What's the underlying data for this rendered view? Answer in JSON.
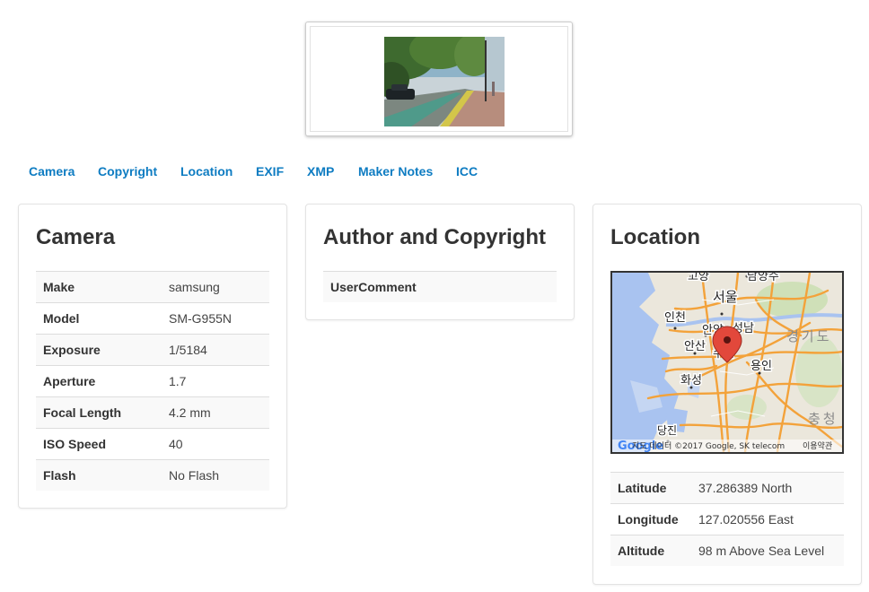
{
  "nav": {
    "tabs": [
      "Camera",
      "Copyright",
      "Location",
      "EXIF",
      "XMP",
      "Maker Notes",
      "ICC"
    ]
  },
  "camera": {
    "title": "Camera",
    "rows": [
      {
        "key": "Make",
        "value": "samsung"
      },
      {
        "key": "Model",
        "value": "SM-G955N"
      },
      {
        "key": "Exposure",
        "value": "1/5184"
      },
      {
        "key": "Aperture",
        "value": "1.7"
      },
      {
        "key": "Focal Length",
        "value": "4.2 mm"
      },
      {
        "key": "ISO Speed",
        "value": "40"
      },
      {
        "key": "Flash",
        "value": "No Flash"
      }
    ]
  },
  "copyright": {
    "title": "Author and Copyright",
    "rows": [
      {
        "key": "UserComment",
        "value": ""
      }
    ]
  },
  "location": {
    "title": "Location",
    "map": {
      "labels": {
        "goyang": "고양",
        "namyangju": "남양주",
        "seoul": "서울",
        "incheon": "인천",
        "anyang": "안양",
        "seongnam": "성남",
        "gyeonggi": "경기도",
        "ansan": "안산",
        "suwon": "수원",
        "yongin": "용인",
        "hwaseong": "화성",
        "chungcheong": "충청",
        "dangjin": "당진"
      },
      "logo": "Google",
      "attribution": "지도 데이터 ©2017 Google, SK telecom",
      "terms": "이용약관"
    },
    "rows": [
      {
        "key": "Latitude",
        "value": "37.286389 North"
      },
      {
        "key": "Longitude",
        "value": "127.020556 East"
      },
      {
        "key": "Altitude",
        "value": "98 m Above Sea Level"
      }
    ]
  },
  "colors": {
    "link": "#0e7cc2",
    "road": "#f3a23a",
    "water": "#a9c3f0",
    "marker": "#e2483b"
  }
}
